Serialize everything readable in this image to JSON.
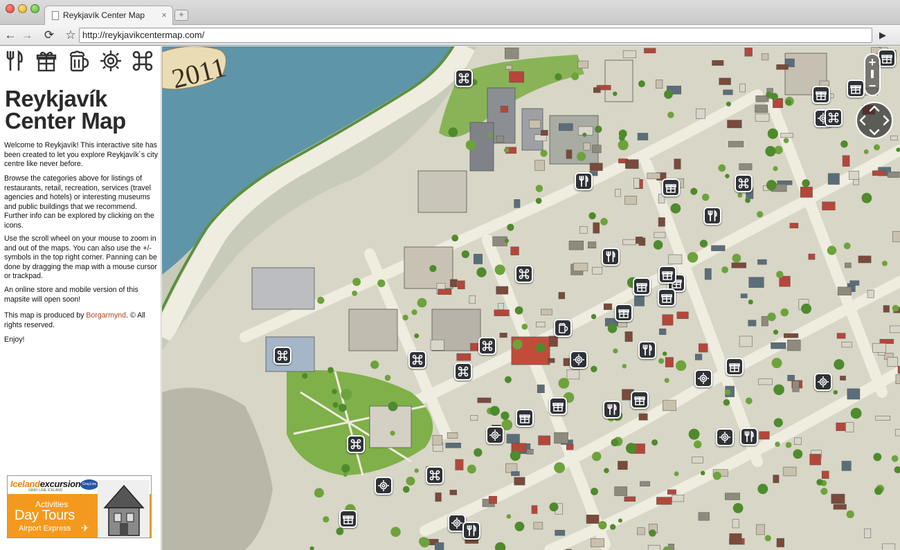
{
  "browser": {
    "tab_title": "Reykjavík Center Map",
    "url": "http://reykjavikcentermap.com/"
  },
  "sidebar": {
    "categories": [
      {
        "name": "restaurants",
        "icon": "fork-knife-icon"
      },
      {
        "name": "retail",
        "icon": "gift-icon"
      },
      {
        "name": "recreation",
        "icon": "beer-mug-icon"
      },
      {
        "name": "services",
        "icon": "sun-gear-icon"
      },
      {
        "name": "museums",
        "icon": "command-icon"
      }
    ],
    "title_line1": "Reykjavík",
    "title_line2": "Center Map",
    "paragraphs": {
      "p1": "Welcome to Reykjavík! This interactive site has been created to let you explore Reykjavík´s city centre like never before.",
      "p2": "Browse the categories above for listings of restaurants, retail, recreation, services (travel agencies and hotels) or interesting museums and public buildings that we recommend. Further info can be explored by clicking on the icons.",
      "p3": "Use the scroll wheel on your mouse to zoom in and out of the maps. You can also use the +/- symbols in the top right corner. Panning can be done by dragging the map with a mouse cursor or trackpad.",
      "p4": "An online store and mobile version of this mapsite will open soon!",
      "p5_before": "This map is produced by ",
      "p5_link": "Borgarmynd",
      "p5_after": ". © All rights reserved.",
      "p6": "Enjoy!"
    },
    "ad": {
      "brand_a": "Iceland",
      "brand_b": "excursions",
      "brand_sub": "GRAY LINE ICELAND",
      "logo": "GrayLine",
      "line1": "Activities",
      "line2": "Day Tours",
      "line3": "Airport Express"
    }
  },
  "map": {
    "year_label": "2011",
    "colors": {
      "water": "#5f95a8",
      "land": "#d8d6c6",
      "road": "#efece0",
      "park": "#7fb04a",
      "pin": "#2f3236"
    },
    "pins": [
      {
        "type": "command-icon"
      },
      {
        "type": "gift-icon"
      },
      {
        "type": "gift-icon"
      },
      {
        "type": "gift-icon"
      },
      {
        "type": "sun-gear-icon"
      },
      {
        "type": "command-icon"
      },
      {
        "type": "fork-knife-icon"
      },
      {
        "type": "gift-icon"
      },
      {
        "type": "command-icon"
      },
      {
        "type": "fork-knife-icon"
      },
      {
        "type": "fork-knife-icon"
      },
      {
        "type": "command-icon"
      },
      {
        "type": "gift-icon"
      },
      {
        "type": "gift-icon"
      },
      {
        "type": "gift-icon"
      },
      {
        "type": "gift-icon"
      },
      {
        "type": "gift-icon"
      },
      {
        "type": "beer-mug-icon"
      },
      {
        "type": "sun-gear-icon"
      },
      {
        "type": "fork-knife-icon"
      },
      {
        "type": "command-icon"
      },
      {
        "type": "command-icon"
      },
      {
        "type": "command-icon"
      },
      {
        "type": "command-icon"
      },
      {
        "type": "gift-icon"
      },
      {
        "type": "sun-gear-icon"
      },
      {
        "type": "sun-gear-icon"
      },
      {
        "type": "gift-icon"
      },
      {
        "type": "gift-icon"
      },
      {
        "type": "fork-knife-icon"
      },
      {
        "type": "gift-icon"
      },
      {
        "type": "sun-gear-icon"
      },
      {
        "type": "command-icon"
      },
      {
        "type": "sun-gear-icon"
      },
      {
        "type": "fork-knife-icon"
      },
      {
        "type": "command-icon"
      },
      {
        "type": "sun-gear-icon"
      },
      {
        "type": "gift-icon"
      },
      {
        "type": "sun-gear-icon"
      },
      {
        "type": "fork-knife-icon"
      }
    ],
    "zoom_in_label": "+",
    "zoom_out_label": "−"
  }
}
